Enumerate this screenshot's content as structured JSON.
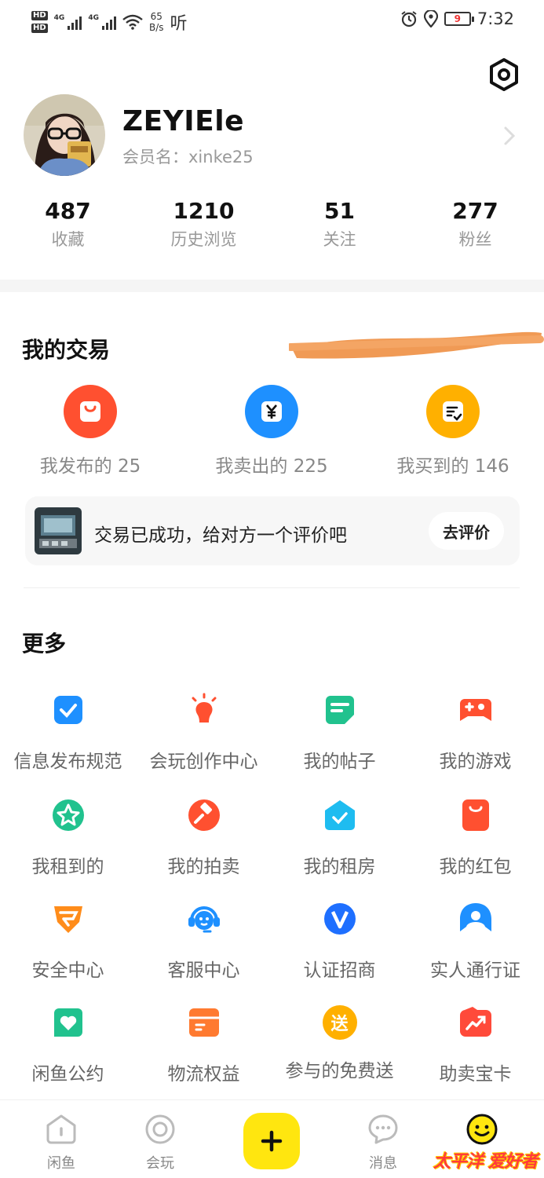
{
  "status_bar": {
    "hd_top": "HD",
    "hd_bottom": "HD",
    "sig1": "4G",
    "sig2": "4G",
    "net_speed": "65",
    "net_unit": "B/s",
    "ting": "听",
    "battery": "9",
    "time": "7:32"
  },
  "profile": {
    "username": "ZEYIEle",
    "member_label": "会员名：xinke25"
  },
  "stats": [
    {
      "value": "487",
      "label": "收藏"
    },
    {
      "value": "1210",
      "label": "历史浏览"
    },
    {
      "value": "51",
      "label": "关注"
    },
    {
      "value": "277",
      "label": "粉丝"
    }
  ],
  "trade": {
    "title": "我的交易",
    "items": [
      {
        "label": "我发布的 25",
        "color": "#ff5030",
        "icon": "bag-icon"
      },
      {
        "label": "我卖出的 225",
        "color": "#1e90ff",
        "icon": "yen-icon"
      },
      {
        "label": "我买到的 146",
        "color": "#ffb000",
        "icon": "receipt-icon"
      }
    ],
    "notice_text": "交易已成功，给对方一个评价吧",
    "notice_button": "去评价"
  },
  "more": {
    "title": "更多",
    "items": [
      {
        "label": "信息发布规范",
        "icon": "checkmark-doc-icon",
        "color": "#1e90ff"
      },
      {
        "label": "会玩创作中心",
        "icon": "lightbulb-icon",
        "color": "#ff5030"
      },
      {
        "label": "我的帖子",
        "icon": "post-icon",
        "color": "#21c28e"
      },
      {
        "label": "我的游戏",
        "icon": "gamepad-icon",
        "color": "#ff5030"
      },
      {
        "label": "我租到的",
        "icon": "star-badge-icon",
        "color": "#21c28e"
      },
      {
        "label": "我的拍卖",
        "icon": "gavel-icon",
        "color": "#ff5030"
      },
      {
        "label": "我的租房",
        "icon": "house-check-icon",
        "color": "#1ebcf0"
      },
      {
        "label": "我的红包",
        "icon": "red-envelope-icon",
        "color": "#ff5030"
      },
      {
        "label": "安全中心",
        "icon": "shield-icon",
        "color": "#ff8c1a"
      },
      {
        "label": "客服中心",
        "icon": "headset-icon",
        "color": "#1e90ff"
      },
      {
        "label": "认证招商",
        "icon": "verified-v-icon",
        "color": "#1e6fff"
      },
      {
        "label": "实人通行证",
        "icon": "person-id-icon",
        "color": "#1e90ff"
      },
      {
        "label": "闲鱼公约",
        "icon": "heart-doc-icon",
        "color": "#21c28e"
      },
      {
        "label": "物流权益",
        "icon": "package-icon",
        "color": "#ff7a30"
      },
      {
        "label": "参与的免费送",
        "icon": "free-gift-icon",
        "color": "#ffb000"
      },
      {
        "label": "助卖宝卡",
        "icon": "boost-card-icon",
        "color": "#ff4a3a"
      }
    ],
    "free_char": "送"
  },
  "tabbar": {
    "tabs": [
      {
        "label": "闲鱼",
        "icon": "home-icon"
      },
      {
        "label": "会玩",
        "icon": "circle-target-icon"
      },
      {
        "label": "消息",
        "icon": "chat-bubble-icon"
      }
    ],
    "publish_icon": "plus-icon",
    "watermark": "太平洋 爱好者"
  }
}
